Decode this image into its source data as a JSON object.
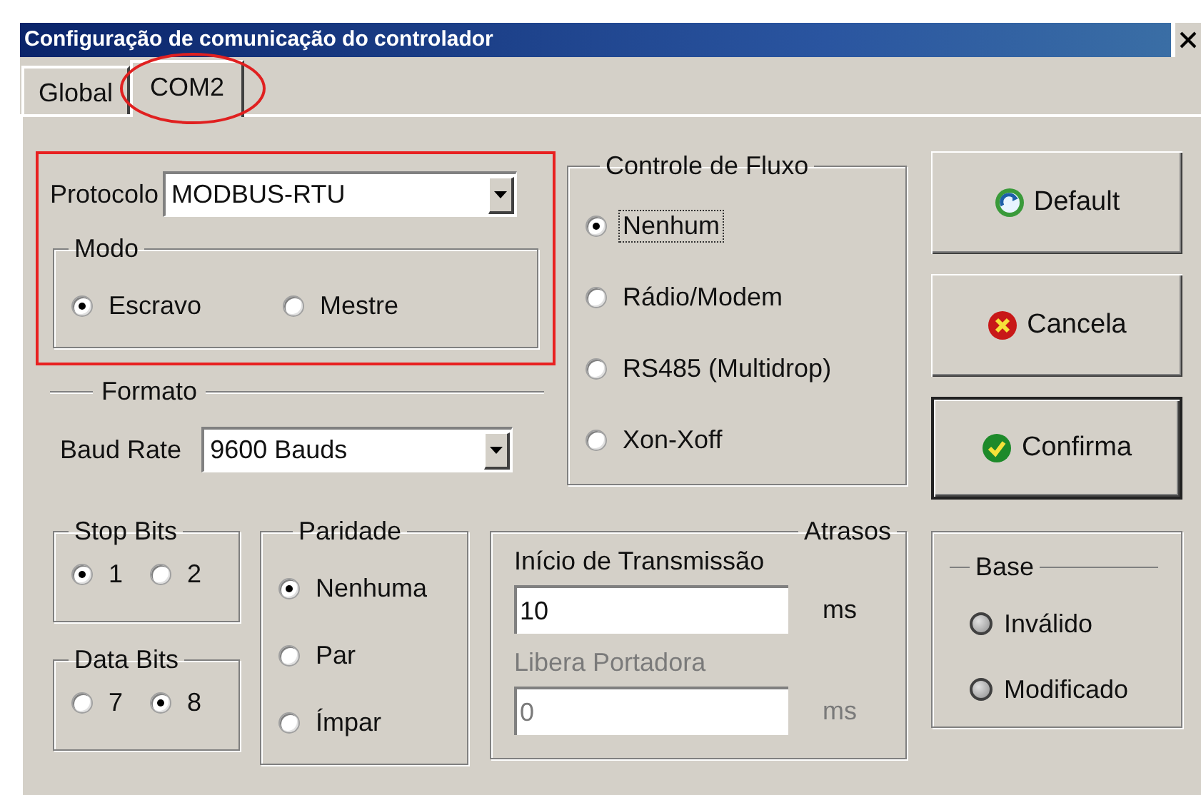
{
  "window": {
    "title": "Configuração de comunicação do controlador"
  },
  "tabs": [
    {
      "label": "Global",
      "selected": false,
      "circled": false
    },
    {
      "label": "COM2",
      "selected": true,
      "circled": true
    }
  ],
  "protocol": {
    "label": "Protocolo",
    "value": "MODBUS-RTU",
    "outlined": true
  },
  "mode": {
    "legend": "Modo",
    "options": [
      {
        "label": "Escravo",
        "selected": true
      },
      {
        "label": "Mestre",
        "selected": false
      }
    ]
  },
  "format": {
    "legend": "Formato",
    "baud_label": "Baud Rate",
    "baud_value": "9600 Bauds"
  },
  "flow_control": {
    "legend": "Controle de Fluxo",
    "options": [
      {
        "label": "Nenhum",
        "selected": true,
        "focused": true
      },
      {
        "label": "Rádio/Modem",
        "selected": false,
        "focused": false
      },
      {
        "label": "RS485 (Multidrop)",
        "selected": false,
        "focused": false
      },
      {
        "label": "Xon-Xoff",
        "selected": false,
        "focused": false
      }
    ]
  },
  "buttons": [
    {
      "label": "Default",
      "kind": "refresh",
      "is_default": false
    },
    {
      "label": "Cancela",
      "kind": "cancel",
      "is_default": false
    },
    {
      "label": "Confirma",
      "kind": "confirm",
      "is_default": true
    }
  ],
  "stop_bits": {
    "legend": "Stop Bits",
    "options": [
      {
        "label": "1",
        "selected": true
      },
      {
        "label": "2",
        "selected": false
      }
    ]
  },
  "data_bits": {
    "legend": "Data Bits",
    "options": [
      {
        "label": "7",
        "selected": false
      },
      {
        "label": "8",
        "selected": true
      }
    ]
  },
  "parity": {
    "legend": "Paridade",
    "options": [
      {
        "label": "Nenhuma",
        "selected": true
      },
      {
        "label": "Par",
        "selected": false
      },
      {
        "label": "Ímpar",
        "selected": false
      }
    ]
  },
  "delays": {
    "legend": "Atrasos",
    "fields": [
      {
        "label": "Início de Transmissão",
        "value": "10",
        "unit": "ms",
        "disabled": false
      },
      {
        "label": "Libera Portadora",
        "value": "0",
        "unit": "ms",
        "disabled": true
      }
    ]
  },
  "base": {
    "legend": "Base",
    "indicators": [
      {
        "label": "Inválido",
        "on": false
      },
      {
        "label": "Modificado",
        "on": false
      }
    ]
  }
}
